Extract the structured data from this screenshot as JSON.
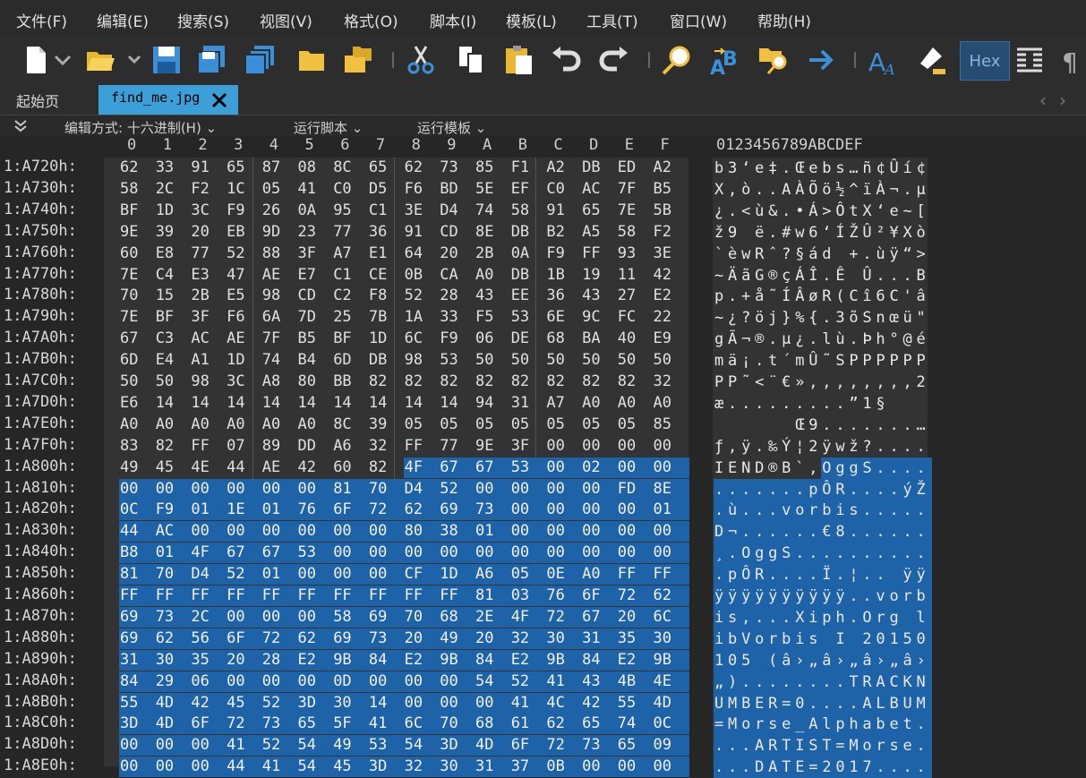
{
  "menu": [
    "文件(F)",
    "编辑(E)",
    "搜索(S)",
    "视图(V)",
    "格式(O)",
    "脚本(I)",
    "模板(L)",
    "工具(T)",
    "窗口(W)",
    "帮助(H)"
  ],
  "toolbar": {
    "icons": [
      "new-file-icon",
      "open-folder-icon",
      "save-icon",
      "save-as-icon",
      "save-all-icon",
      "folder-icon",
      "folder-multi-icon",
      "cut-icon",
      "copy-icon",
      "paste-icon",
      "undo-icon",
      "redo-icon",
      "find-icon",
      "replace-icon",
      "find-in-files-icon",
      "goto-icon",
      "font-icon",
      "highlight-icon",
      "hex-mode-icon",
      "columns-icon",
      "pilcrow-icon"
    ],
    "hex_label": "Hex"
  },
  "tabs": {
    "home": "起始页",
    "active": "find_me.jpg"
  },
  "options": {
    "edit_mode": "编辑方式: 十六进制(H)",
    "run_script": "运行脚本",
    "run_template": "运行模板"
  },
  "colors": {
    "selection": "#1e62a8",
    "tab_active": "#3d9fd8",
    "panel": "#333333"
  },
  "hex_headers": [
    "0",
    "1",
    "2",
    "3",
    "4",
    "5",
    "6",
    "7",
    "8",
    "9",
    "A",
    "B",
    "C",
    "D",
    "E",
    "F"
  ],
  "ascii_header": "0123456789ABCDEF",
  "rows": [
    {
      "addr": "1:A720h:",
      "bytes": [
        "62",
        "33",
        "91",
        "65",
        "87",
        "08",
        "8C",
        "65",
        "62",
        "73",
        "85",
        "F1",
        "A2",
        "DB",
        "ED",
        "A2"
      ],
      "ascii": "b3‘e‡.Œebs…ñ¢Ûí¢"
    },
    {
      "addr": "1:A730h:",
      "bytes": [
        "58",
        "2C",
        "F2",
        "1C",
        "05",
        "41",
        "C0",
        "D5",
        "F6",
        "BD",
        "5E",
        "EF",
        "C0",
        "AC",
        "7F",
        "B5"
      ],
      "ascii": "X,ò..AÀÕö½^ïÀ¬.µ"
    },
    {
      "addr": "1:A740h:",
      "bytes": [
        "BF",
        "1D",
        "3C",
        "F9",
        "26",
        "0A",
        "95",
        "C1",
        "3E",
        "D4",
        "74",
        "58",
        "91",
        "65",
        "7E",
        "5B"
      ],
      "ascii": "¿.<ù&.•Á>ÔtX‘e~["
    },
    {
      "addr": "1:A750h:",
      "bytes": [
        "9E",
        "39",
        "20",
        "EB",
        "9D",
        "23",
        "77",
        "36",
        "91",
        "CD",
        "8E",
        "DB",
        "B2",
        "A5",
        "58",
        "F2"
      ],
      "ascii": "ž9 ë.#w6‘ÍŽÛ²¥Xò"
    },
    {
      "addr": "1:A760h:",
      "bytes": [
        "60",
        "E8",
        "77",
        "52",
        "88",
        "3F",
        "A7",
        "E1",
        "64",
        "20",
        "2B",
        "0A",
        "F9",
        "FF",
        "93",
        "3E"
      ],
      "ascii": "`èwRˆ?§ád +.ùÿ“>"
    },
    {
      "addr": "1:A770h:",
      "bytes": [
        "7E",
        "C4",
        "E3",
        "47",
        "AE",
        "E7",
        "C1",
        "CE",
        "0B",
        "CA",
        "A0",
        "DB",
        "1B",
        "19",
        "11",
        "42"
      ],
      "ascii": "~ÄãG®çÁÎ.Ê Û...B"
    },
    {
      "addr": "1:A780h:",
      "bytes": [
        "70",
        "15",
        "2B",
        "E5",
        "98",
        "CD",
        "C2",
        "F8",
        "52",
        "28",
        "43",
        "EE",
        "36",
        "43",
        "27",
        "E2"
      ],
      "ascii": "p.+å˜ÍÂøR(Cî6C'â"
    },
    {
      "addr": "1:A790h:",
      "bytes": [
        "7E",
        "BF",
        "3F",
        "F6",
        "6A",
        "7D",
        "25",
        "7B",
        "1A",
        "33",
        "F5",
        "53",
        "6E",
        "9C",
        "FC",
        "22"
      ],
      "ascii": "~¿?öj}%{.3õSnœü\""
    },
    {
      "addr": "1:A7A0h:",
      "bytes": [
        "67",
        "C3",
        "AC",
        "AE",
        "7F",
        "B5",
        "BF",
        "1D",
        "6C",
        "F9",
        "06",
        "DE",
        "68",
        "BA",
        "40",
        "E9"
      ],
      "ascii": "gÃ¬®.µ¿.lù.Þh°@é"
    },
    {
      "addr": "1:A7B0h:",
      "bytes": [
        "6D",
        "E4",
        "A1",
        "1D",
        "74",
        "B4",
        "6D",
        "DB",
        "98",
        "53",
        "50",
        "50",
        "50",
        "50",
        "50",
        "50"
      ],
      "ascii": "mä¡.t´mÛ˜SPPPPPP"
    },
    {
      "addr": "1:A7C0h:",
      "bytes": [
        "50",
        "50",
        "98",
        "3C",
        "A8",
        "80",
        "BB",
        "82",
        "82",
        "82",
        "82",
        "82",
        "82",
        "82",
        "82",
        "32"
      ],
      "ascii": "PP˜<¨€»‚‚‚‚‚‚‚‚2"
    },
    {
      "addr": "1:A7D0h:",
      "bytes": [
        "E6",
        "14",
        "14",
        "14",
        "14",
        "14",
        "14",
        "14",
        "14",
        "14",
        "94",
        "31",
        "A7",
        "A0",
        "A0",
        "A0"
      ],
      "ascii": "æ.........”1§   "
    },
    {
      "addr": "1:A7E0h:",
      "bytes": [
        "A0",
        "A0",
        "A0",
        "A0",
        "A0",
        "A0",
        "8C",
        "39",
        "05",
        "05",
        "05",
        "05",
        "05",
        "05",
        "05",
        "85"
      ],
      "ascii": "      Œ9.......…"
    },
    {
      "addr": "1:A7F0h:",
      "bytes": [
        "83",
        "82",
        "FF",
        "07",
        "89",
        "DD",
        "A6",
        "32",
        "FF",
        "77",
        "9E",
        "3F",
        "00",
        "00",
        "00",
        "00"
      ],
      "ascii": "ƒ‚ÿ.‰Ý¦2ÿwž?...."
    },
    {
      "addr": "1:A800h:",
      "bytes": [
        "49",
        "45",
        "4E",
        "44",
        "AE",
        "42",
        "60",
        "82",
        "4F",
        "67",
        "67",
        "53",
        "00",
        "02",
        "00",
        "00"
      ],
      "ascii": "IEND®B`‚OggS....",
      "sel_from": 8
    },
    {
      "addr": "1:A810h:",
      "bytes": [
        "00",
        "00",
        "00",
        "00",
        "00",
        "00",
        "81",
        "70",
        "D4",
        "52",
        "00",
        "00",
        "00",
        "00",
        "FD",
        "8E"
      ],
      "ascii": ".......pÔR....ýŽ",
      "sel_from": 0
    },
    {
      "addr": "1:A820h:",
      "bytes": [
        "0C",
        "F9",
        "01",
        "1E",
        "01",
        "76",
        "6F",
        "72",
        "62",
        "69",
        "73",
        "00",
        "00",
        "00",
        "00",
        "01"
      ],
      "ascii": ".ù...vorbis.....",
      "sel_from": 0
    },
    {
      "addr": "1:A830h:",
      "bytes": [
        "44",
        "AC",
        "00",
        "00",
        "00",
        "00",
        "00",
        "00",
        "80",
        "38",
        "01",
        "00",
        "00",
        "00",
        "00",
        "00"
      ],
      "ascii": "D¬......€8......",
      "sel_from": 0
    },
    {
      "addr": "1:A840h:",
      "bytes": [
        "B8",
        "01",
        "4F",
        "67",
        "67",
        "53",
        "00",
        "00",
        "00",
        "00",
        "00",
        "00",
        "00",
        "00",
        "00",
        "00"
      ],
      "ascii": "¸.OggS..........",
      "sel_from": 0
    },
    {
      "addr": "1:A850h:",
      "bytes": [
        "81",
        "70",
        "D4",
        "52",
        "01",
        "00",
        "00",
        "00",
        "CF",
        "1D",
        "A6",
        "05",
        "0E",
        "A0",
        "FF",
        "FF"
      ],
      "ascii": ".pÔR....Ï.¦.. ÿÿ",
      "sel_from": 0
    },
    {
      "addr": "1:A860h:",
      "bytes": [
        "FF",
        "FF",
        "FF",
        "FF",
        "FF",
        "FF",
        "FF",
        "FF",
        "FF",
        "FF",
        "81",
        "03",
        "76",
        "6F",
        "72",
        "62"
      ],
      "ascii": "ÿÿÿÿÿÿÿÿÿÿ..vorb",
      "sel_from": 0
    },
    {
      "addr": "1:A870h:",
      "bytes": [
        "69",
        "73",
        "2C",
        "00",
        "00",
        "00",
        "58",
        "69",
        "70",
        "68",
        "2E",
        "4F",
        "72",
        "67",
        "20",
        "6C"
      ],
      "ascii": "is,...Xiph.Org l",
      "sel_from": 0
    },
    {
      "addr": "1:A880h:",
      "bytes": [
        "69",
        "62",
        "56",
        "6F",
        "72",
        "62",
        "69",
        "73",
        "20",
        "49",
        "20",
        "32",
        "30",
        "31",
        "35",
        "30"
      ],
      "ascii": "ibVorbis I 20150",
      "sel_from": 0
    },
    {
      "addr": "1:A890h:",
      "bytes": [
        "31",
        "30",
        "35",
        "20",
        "28",
        "E2",
        "9B",
        "84",
        "E2",
        "9B",
        "84",
        "E2",
        "9B",
        "84",
        "E2",
        "9B"
      ],
      "ascii": "105 (â›„â›„â›„â›",
      "sel_from": 0
    },
    {
      "addr": "1:A8A0h:",
      "bytes": [
        "84",
        "29",
        "06",
        "00",
        "00",
        "00",
        "0D",
        "00",
        "00",
        "00",
        "54",
        "52",
        "41",
        "43",
        "4B",
        "4E"
      ],
      "ascii": "„)........TRACKN",
      "sel_from": 0
    },
    {
      "addr": "1:A8B0h:",
      "bytes": [
        "55",
        "4D",
        "42",
        "45",
        "52",
        "3D",
        "30",
        "14",
        "00",
        "00",
        "00",
        "41",
        "4C",
        "42",
        "55",
        "4D"
      ],
      "ascii": "UMBER=0....ALBUM",
      "sel_from": 0
    },
    {
      "addr": "1:A8C0h:",
      "bytes": [
        "3D",
        "4D",
        "6F",
        "72",
        "73",
        "65",
        "5F",
        "41",
        "6C",
        "70",
        "68",
        "61",
        "62",
        "65",
        "74",
        "0C"
      ],
      "ascii": "=Morse_Alphabet.",
      "sel_from": 0
    },
    {
      "addr": "1:A8D0h:",
      "bytes": [
        "00",
        "00",
        "00",
        "41",
        "52",
        "54",
        "49",
        "53",
        "54",
        "3D",
        "4D",
        "6F",
        "72",
        "73",
        "65",
        "09"
      ],
      "ascii": "...ARTIST=Morse.",
      "sel_from": 0
    },
    {
      "addr": "1:A8E0h:",
      "bytes": [
        "00",
        "00",
        "00",
        "44",
        "41",
        "54",
        "45",
        "3D",
        "32",
        "30",
        "31",
        "37",
        "0B",
        "00",
        "00",
        "00"
      ],
      "ascii": "...DATE=2017....",
      "sel_from": 0
    }
  ]
}
